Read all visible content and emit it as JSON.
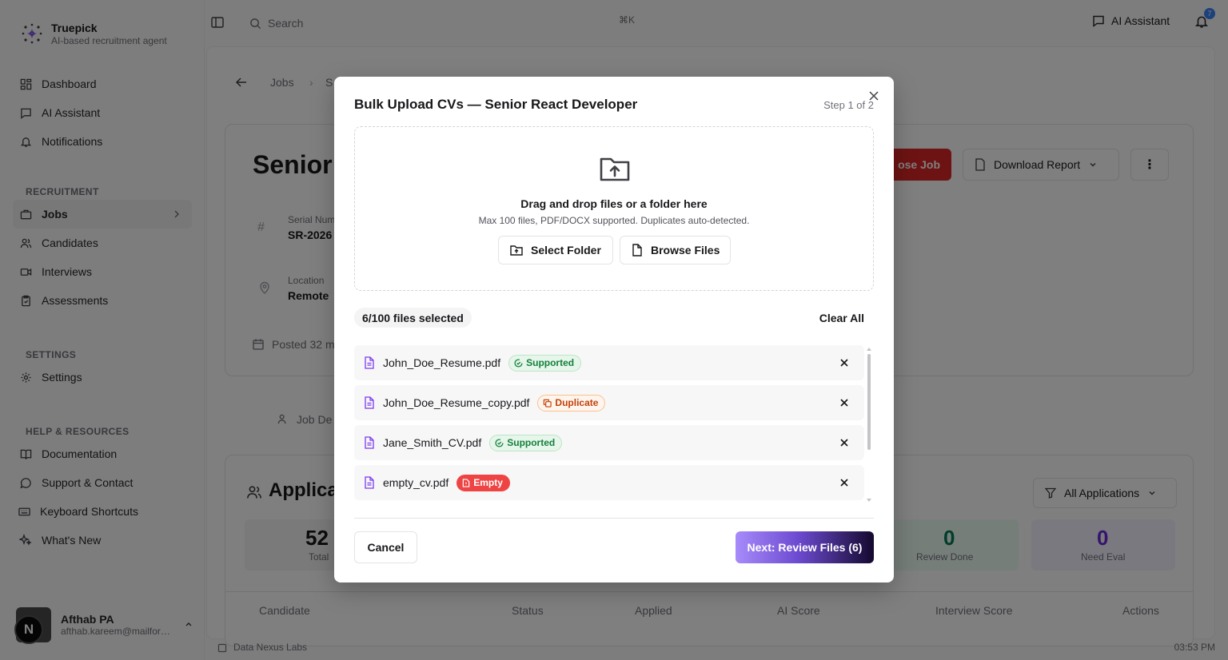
{
  "brand": {
    "name": "Truepick",
    "subtitle": "AI-based recruitment agent"
  },
  "sidebar": {
    "main_items": [
      {
        "label": "Dashboard",
        "icon": "dashboard-icon"
      },
      {
        "label": "AI Assistant",
        "icon": "chat-icon"
      },
      {
        "label": "Notifications",
        "icon": "bell-icon"
      }
    ],
    "recruitment_label": "RECRUITMENT",
    "recruitment_items": [
      {
        "label": "Jobs",
        "icon": "briefcase-icon",
        "active": true
      },
      {
        "label": "Candidates",
        "icon": "users-icon"
      },
      {
        "label": "Interviews",
        "icon": "video-icon"
      },
      {
        "label": "Assessments",
        "icon": "clipboard-icon"
      }
    ],
    "settings_label": "SETTINGS",
    "settings_items": [
      {
        "label": "Settings",
        "icon": "gear-icon"
      }
    ],
    "help_label": "HELP & RESOURCES",
    "help_items": [
      {
        "label": "Documentation",
        "icon": "book-icon"
      },
      {
        "label": "Support & Contact",
        "icon": "chat-icon"
      },
      {
        "label": "Keyboard Shortcuts",
        "icon": "keyboard-icon"
      },
      {
        "label": "What's New",
        "icon": "sparkle-icon"
      }
    ],
    "user": {
      "name": "Afthab PA",
      "email": "afthab.kareem@mailfors...",
      "badge": "N"
    }
  },
  "topbar": {
    "search_placeholder": "Search",
    "shortcut": "⌘K",
    "ai_assistant": "AI Assistant",
    "notification_count": "7"
  },
  "background": {
    "breadcrumb_jobs": "Jobs",
    "breadcrumb_cut": "S",
    "job_title_cut": "Senior",
    "serial_label": "Serial Num",
    "serial_value": "SR-2026",
    "location_label": "Location",
    "location_value": "Remote",
    "posted": "Posted 32 m",
    "close_job": "ose Job",
    "download_report": "Download Report",
    "tab_job_details": "Job De",
    "applications_title": "Applica",
    "all_applications": "All Applications",
    "stats": [
      {
        "value": "52",
        "label": "Total"
      },
      {
        "value": "0",
        "label": "Review Done"
      },
      {
        "value": "0",
        "label": "Need Eval"
      }
    ],
    "columns": [
      "Candidate",
      "Status",
      "Applied",
      "AI Score",
      "Interview Score",
      "Actions"
    ]
  },
  "footer": {
    "org": "Data Nexus Labs",
    "time": "03:53 PM"
  },
  "modal": {
    "title": "Bulk Upload CVs — Senior React Developer",
    "step": "Step 1 of 2",
    "dropzone_title": "Drag and drop files or a folder here",
    "dropzone_sub": "Max 100 files, PDF/DOCX supported. Duplicates auto-detected.",
    "select_folder": "Select Folder",
    "browse_files": "Browse Files",
    "selected_count": "6/100 files selected",
    "clear_all": "Clear All",
    "files": [
      {
        "name": "John_Doe_Resume.pdf",
        "status": "Supported",
        "kind": "sup"
      },
      {
        "name": "John_Doe_Resume_copy.pdf",
        "status": "Duplicate",
        "kind": "dup"
      },
      {
        "name": "Jane_Smith_CV.pdf",
        "status": "Supported",
        "kind": "sup"
      },
      {
        "name": "empty_cv.pdf",
        "status": "Empty",
        "kind": "emp"
      }
    ],
    "cancel": "Cancel",
    "next": "Next: Review Files (6)"
  }
}
